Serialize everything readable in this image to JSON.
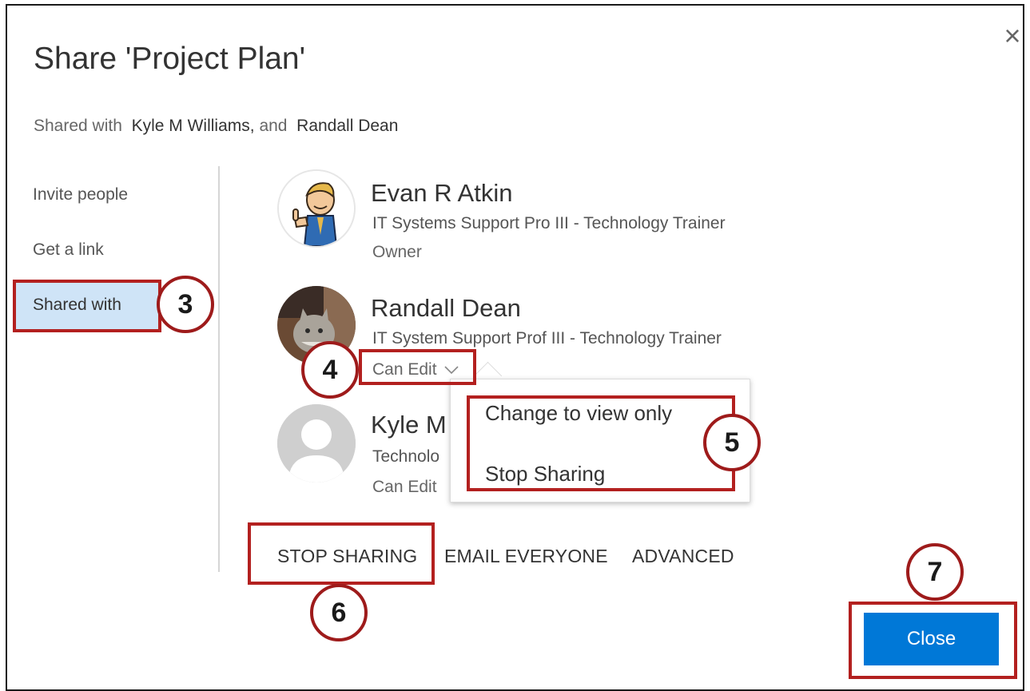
{
  "dialog": {
    "title": "Share 'Project Plan'",
    "close_icon": "×",
    "shared_with_prefix": "Shared with",
    "shared_with_names": [
      "Kyle M Williams,",
      "Randall Dean"
    ],
    "shared_with_conjunction": "and"
  },
  "nav": {
    "items": [
      {
        "label": "Invite people"
      },
      {
        "label": "Get a link"
      },
      {
        "label": "Shared with",
        "active": true
      }
    ]
  },
  "people": [
    {
      "name": "Evan R Atkin",
      "title": "IT Systems Support Pro III - Technology Trainer",
      "permission": "Owner"
    },
    {
      "name": "Randall Dean",
      "title": "IT System Support Prof III - Technology Trainer",
      "permission": "Can Edit"
    },
    {
      "name": "Kyle M",
      "title": "Technolo",
      "permission": "Can Edit"
    }
  ],
  "permission_menu": {
    "items": [
      "Change to view only",
      "Stop Sharing"
    ]
  },
  "actions": {
    "stop_sharing": "STOP SHARING",
    "email_everyone": "EMAIL EVERYONE",
    "advanced": "ADVANCED"
  },
  "close_button": "Close",
  "callouts": [
    "3",
    "4",
    "5",
    "6",
    "7"
  ],
  "colors": {
    "accent": "#0078d7",
    "nav_active_bg": "#cfe4f7",
    "callout_red": "#b3201f"
  }
}
